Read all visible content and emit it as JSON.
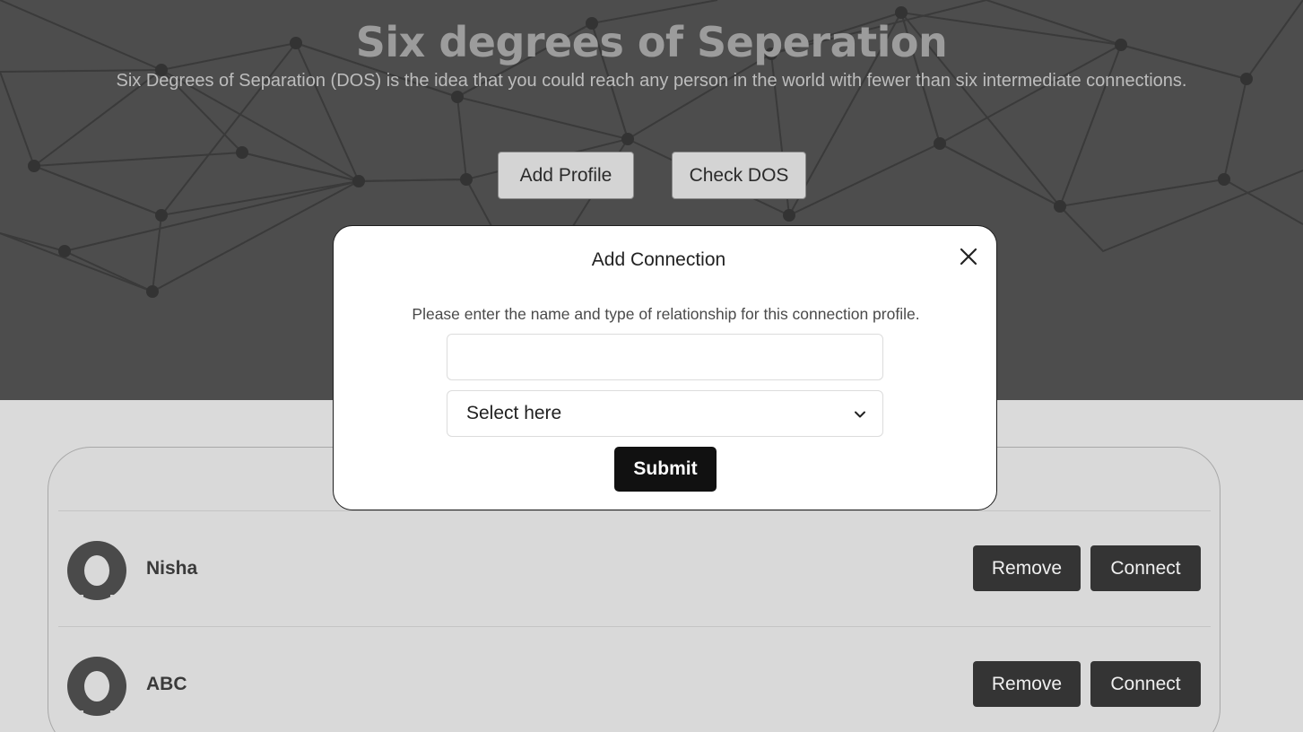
{
  "header": {
    "title": "Six degrees of Seperation",
    "subtitle": "Six Degrees of Separation (DOS) is the idea that you could reach any person in the world with fewer than six intermediate connections.",
    "add_profile_label": "Add Profile",
    "check_dos_label": "Check DOS"
  },
  "modal": {
    "title": "Add Connection",
    "description": "Please enter the name and type of relationship for this connection profile.",
    "name_value": "",
    "select_value": "Select here",
    "submit_label": "Submit",
    "close_icon": "close-icon"
  },
  "profiles": [
    {
      "name": "Nisha",
      "remove_label": "Remove",
      "connect_label": "Connect"
    },
    {
      "name": "ABC",
      "remove_label": "Remove",
      "connect_label": "Connect"
    }
  ],
  "colors": {
    "hero_bg": "#4d4d4d",
    "page_bg": "#dadada",
    "dark_button": "#343434",
    "submit_button": "#111111"
  }
}
